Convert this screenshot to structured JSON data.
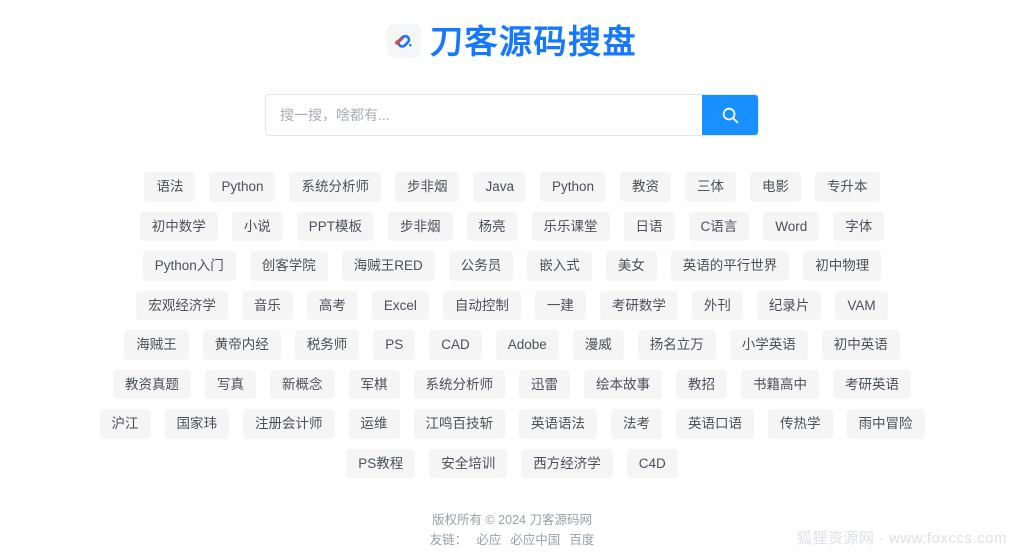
{
  "header": {
    "logo_icon": "link-chain-icon",
    "title": "刀客源码搜盘",
    "brand_color": "#1677ff"
  },
  "search": {
    "placeholder": "搜一搜，啥都有...",
    "value": "",
    "button_icon": "search-icon",
    "button_color": "#1890ff"
  },
  "tag_rows": [
    [
      "语法",
      "Python",
      "系统分析师",
      "步非烟",
      "Java",
      "Python",
      "教资",
      "三体",
      "电影",
      "专升本"
    ],
    [
      "初中数学",
      "小说",
      "PPT模板",
      "步非烟",
      "杨亮",
      "乐乐课堂",
      "日语",
      "C语言",
      "Word",
      "字体"
    ],
    [
      "Python入门",
      "创客学院",
      "海贼王RED",
      "公务员",
      "嵌入式",
      "美女",
      "英语的平行世界",
      "初中物理"
    ],
    [
      "宏观经济学",
      "音乐",
      "高考",
      "Excel",
      "自动控制",
      "一建",
      "考研数学",
      "外刊",
      "纪录片",
      "VAM"
    ],
    [
      "海贼王",
      "黄帝内经",
      "税务师",
      "PS",
      "CAD",
      "Adobe",
      "漫威",
      "扬名立万",
      "小学英语",
      "初中英语"
    ],
    [
      "教资真题",
      "写真",
      "新概念",
      "军棋",
      "系统分析师",
      "迅雷",
      "绘本故事",
      "教招",
      "书籍高中",
      "考研英语"
    ],
    [
      "沪江",
      "国家玮",
      "注册会计师",
      "运维",
      "江鸣百技斩",
      "英语语法",
      "法考",
      "英语口语",
      "传热学",
      "雨中冒险"
    ],
    [
      "PS教程",
      "安全培训",
      "西方经济学",
      "C4D"
    ]
  ],
  "footer": {
    "copyright": "版权所有 © 2024 刀客源码网",
    "links_label": "友链：",
    "links": [
      "必应",
      "必应中国",
      "百度"
    ]
  },
  "watermark": {
    "text": "狐狸资源网 · www.foxccs.com"
  }
}
